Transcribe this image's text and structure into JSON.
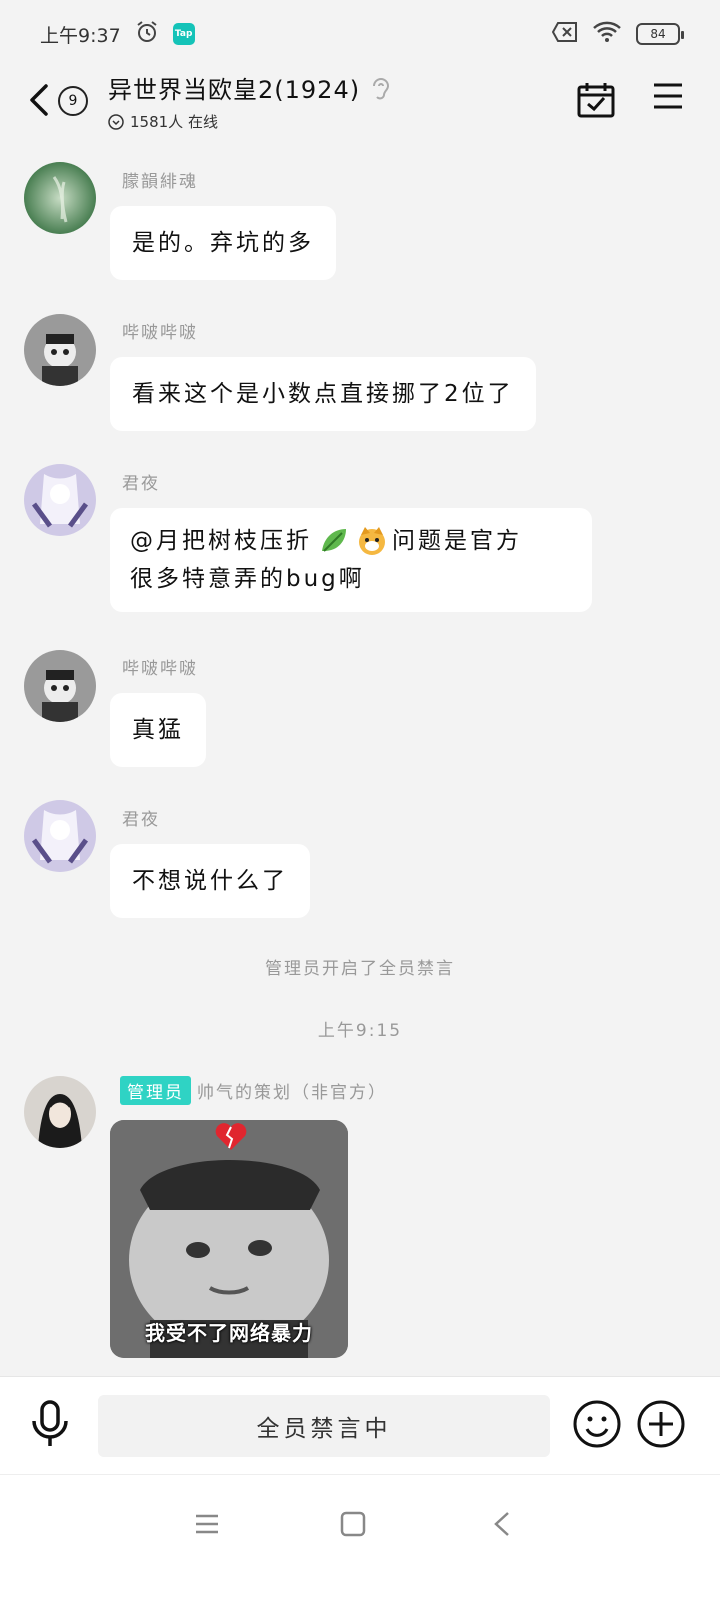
{
  "status_bar": {
    "time": "上午9:37",
    "app_badge": "Tap",
    "battery": "84"
  },
  "header": {
    "title": "异世界当欧皇2(1924)",
    "unread_count": "9",
    "online": "1581人 在线"
  },
  "messages": [
    {
      "sender": "朦韻緋魂",
      "text": "是的。弃坑的多"
    },
    {
      "sender": "哔啵哔啵",
      "text": "看来这个是小数点直接挪了2位了"
    },
    {
      "sender": "君夜",
      "line1_prefix": "@月把树枝压折",
      "line1_suffix": "问题是官方",
      "line2": "很多特意弄的bug啊"
    },
    {
      "sender": "哔啵哔啵",
      "text": "真猛"
    },
    {
      "sender": "君夜",
      "text": "不想说什么了"
    }
  ],
  "system": {
    "mute_notice": "管理员开启了全员禁言",
    "timestamp": "上午9:15"
  },
  "admin_message": {
    "role_tag": "管理员",
    "sender": "帅气的策划（非官方）",
    "sticker_caption": "我受不了网络暴力"
  },
  "input_bar": {
    "status_text": "全员禁言中"
  },
  "colors": {
    "accent_teal": "#2fd3c4",
    "background": "#f3f3f3"
  }
}
